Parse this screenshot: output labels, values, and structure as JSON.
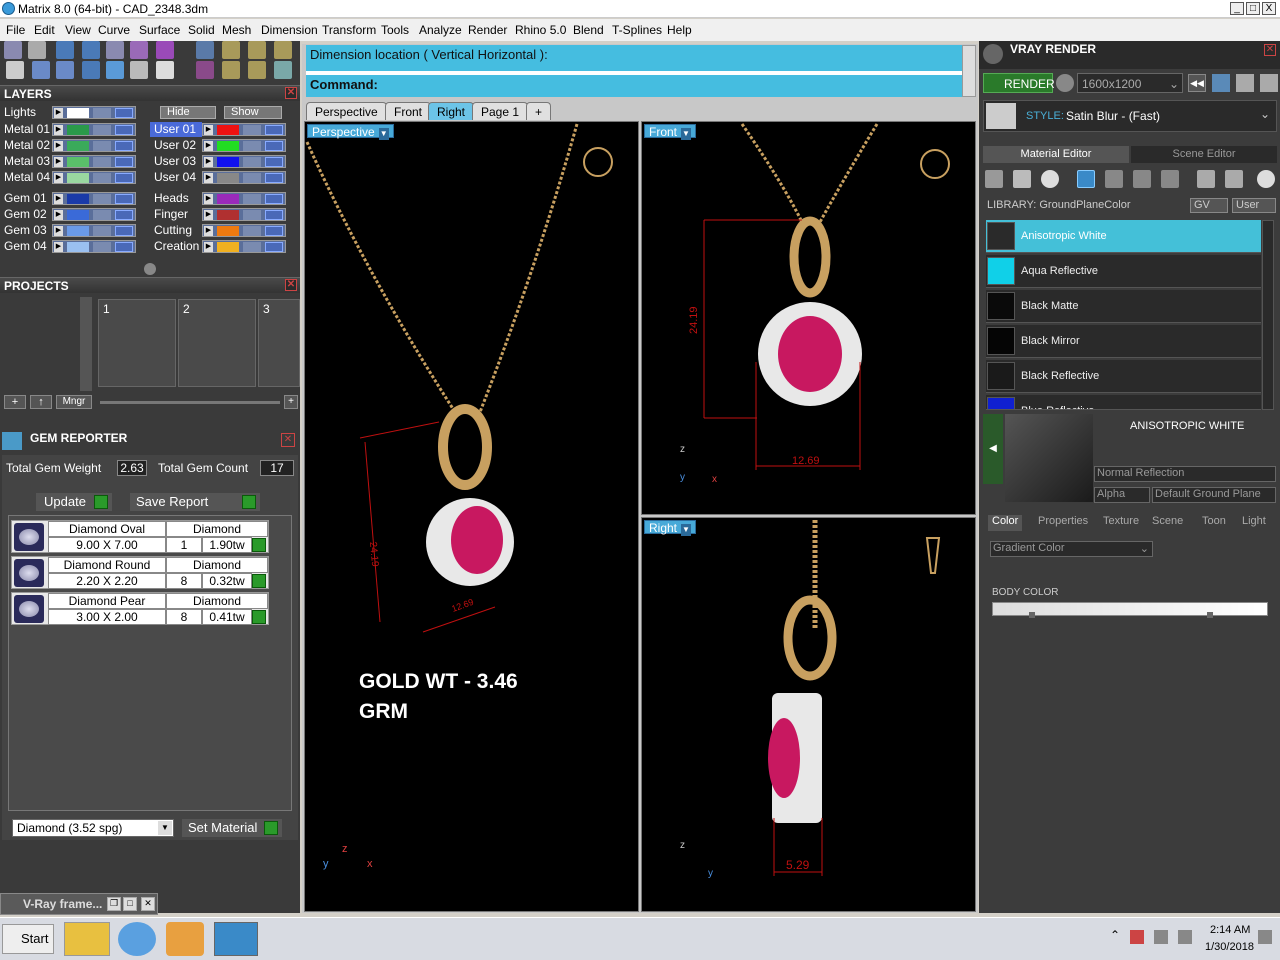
{
  "window": {
    "title": "Matrix 8.0 (64-bit) - CAD_2348.3dm",
    "min": "_",
    "max": "□",
    "close": "X"
  },
  "menu": [
    "File",
    "Edit",
    "View",
    "Curve",
    "Surface",
    "Solid",
    "Mesh",
    "Dimension",
    "Transform",
    "Tools",
    "Analyze",
    "Render",
    "Rhino 5.0",
    "Blend",
    "T-Splines",
    "Help"
  ],
  "layers": {
    "header": "LAYERS",
    "lights": "Lights",
    "hide": "Hide",
    "show": "Show",
    "left": [
      {
        "name": "Metal 01",
        "color": "#2a9a4a"
      },
      {
        "name": "Metal 02",
        "color": "#3aaa5a"
      },
      {
        "name": "Metal 03",
        "color": "#5ac06a"
      },
      {
        "name": "Metal 04",
        "color": "#9ad8a0"
      },
      {
        "name": "Gem 01",
        "color": "#1a3aa8"
      },
      {
        "name": "Gem 02",
        "color": "#3a6ad8"
      },
      {
        "name": "Gem 03",
        "color": "#6a9ae8"
      },
      {
        "name": "Gem 04",
        "color": "#9ac0f0"
      }
    ],
    "right": [
      {
        "name": "User 01",
        "color": "#ee1111"
      },
      {
        "name": "User 02",
        "color": "#22dd22"
      },
      {
        "name": "User 03",
        "color": "#1111ee"
      },
      {
        "name": "User 04",
        "color": "#888888"
      },
      {
        "name": "Heads",
        "color": "#9a2aba"
      },
      {
        "name": "Finger",
        "color": "#b03030"
      },
      {
        "name": "Cutting",
        "color": "#ee7a10"
      },
      {
        "name": "Creation",
        "color": "#f0b020"
      }
    ]
  },
  "projects": {
    "header": "PROJECTS",
    "slots": [
      "1",
      "2",
      "3"
    ],
    "mngr": "Mngr"
  },
  "gem_reporter": {
    "header": "GEM REPORTER",
    "weight_label": "Total Gem Weight",
    "weight": "2.63",
    "count_label": "Total Gem Count",
    "count": "17",
    "update": "Update",
    "save_report": "Save Report",
    "gems": [
      {
        "name": "Diamond Oval",
        "size": "9.00 X 7.00",
        "material": "Diamond",
        "qty": "1",
        "tw": "1.90tw"
      },
      {
        "name": "Diamond Round",
        "size": "2.20 X 2.20",
        "material": "Diamond",
        "qty": "8",
        "tw": "0.32tw"
      },
      {
        "name": "Diamond Pear",
        "size": "3.00 X 2.00",
        "material": "Diamond",
        "qty": "8",
        "tw": "0.41tw"
      }
    ],
    "material_select": "Diamond     (3.52 spg)",
    "set_material": "Set Material"
  },
  "vray_frame": "V-Ray frame...",
  "command": {
    "prompt": "Dimension location ( Vertical  Horizontal ):",
    "label": "Command:"
  },
  "tabs": [
    "Perspective",
    "Front",
    "Right",
    "Page 1",
    "+"
  ],
  "viewports": {
    "perspective": {
      "label": "Perspective",
      "dim1": "24.19",
      "dim2": "12.69"
    },
    "front": {
      "label": "Front",
      "dim_v": "24.19",
      "dim_h": "12.69"
    },
    "right": {
      "label": "Right",
      "dim_h": "5.29"
    },
    "gold_wt_line1": "GOLD WT  - 3.46",
    "gold_wt_line2": "GRM"
  },
  "vray": {
    "header": "VRAY RENDER",
    "render": "RENDER",
    "resolution": "1600x1200",
    "style_label": "STYLE:",
    "style_value": "Satin Blur - (Fast)",
    "tab_material": "Material Editor",
    "tab_scene": "Scene Editor",
    "library": "LIBRARY: GroundPlaneColor",
    "gv": "GV",
    "user": "User",
    "materials": [
      {
        "name": "Anisotropic White",
        "color": "#2a2a2a",
        "selected": true
      },
      {
        "name": "Aqua Reflective",
        "color": "#10d0e8",
        "selected": false
      },
      {
        "name": "Black Matte",
        "color": "#0a0a0a",
        "selected": false
      },
      {
        "name": "Black Mirror",
        "color": "#050505",
        "selected": false
      },
      {
        "name": "Black Reflective",
        "color": "#1a1a1a",
        "selected": false
      },
      {
        "name": "Blue Reflective",
        "color": "#1020d0",
        "selected": false
      }
    ],
    "preview_title": "ANISOTROPIC WHITE",
    "reflection": "Normal Reflection",
    "alpha": "Alpha",
    "ground": "Default Ground Plane",
    "prop_tabs": [
      "Color",
      "Properties",
      "Texture",
      "Scene",
      "Toon",
      "Light"
    ],
    "gradient": "Gradient Color",
    "body_color": "BODY COLOR"
  },
  "taskbar": {
    "start": "Start",
    "time": "2:14 AM",
    "date": "1/30/2018"
  }
}
